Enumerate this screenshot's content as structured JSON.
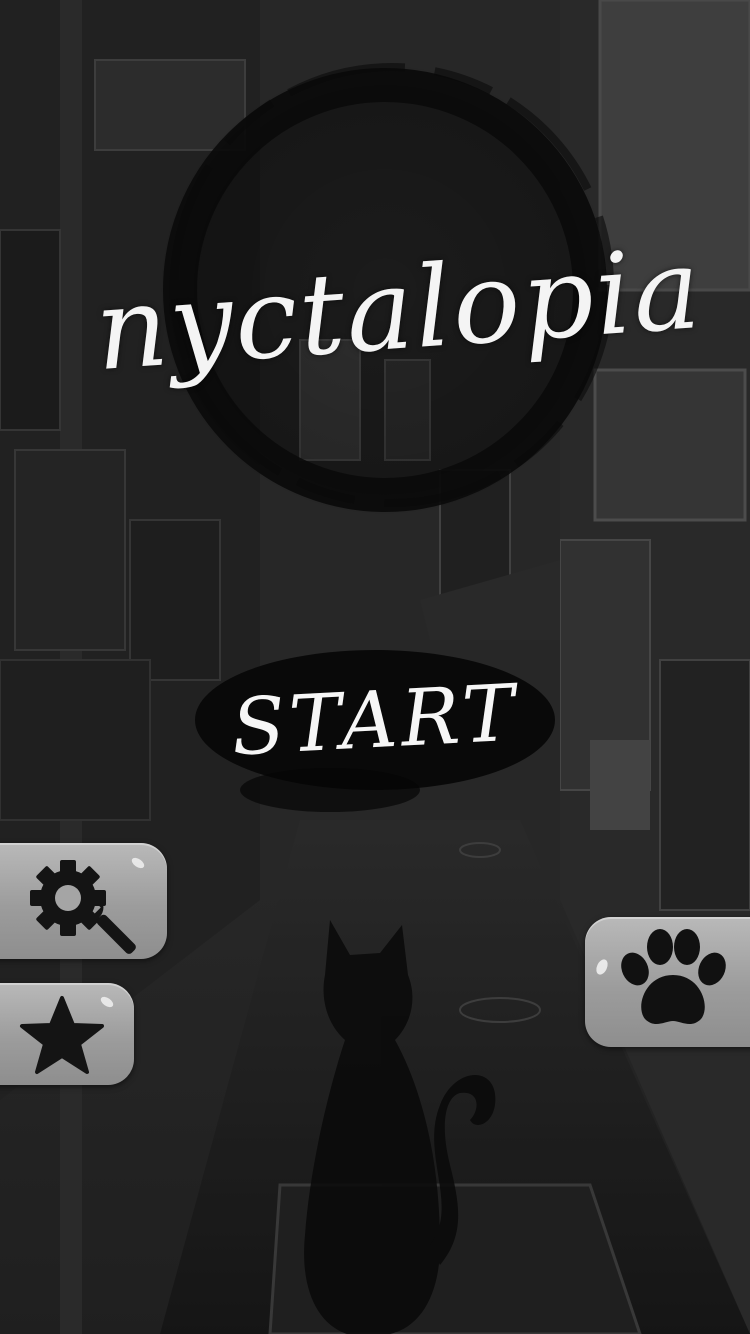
{
  "game": {
    "title": "nyctalopia",
    "start_label": "START"
  },
  "buttons": {
    "settings_icon": "gear-wrench-icon",
    "favorites_icon": "star-icon",
    "pets_icon": "paw-icon"
  },
  "colors": {
    "background": "#2a2a2a",
    "ink": "#0b0b0b",
    "text": "#f4f4f4",
    "button": "#a8a8a8"
  }
}
